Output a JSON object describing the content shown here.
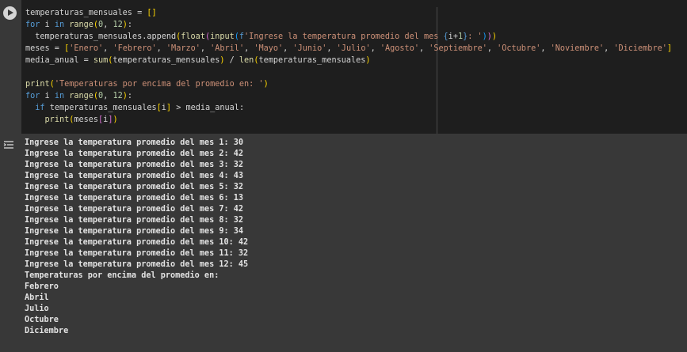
{
  "cell": {
    "run_button_icon": "play-icon",
    "output_icon": "output-toggle-icon",
    "code_lines": [
      [
        {
          "c": "var",
          "t": "temperaturas_mensuales"
        },
        {
          "c": "op",
          "t": " = "
        },
        {
          "c": "br1",
          "t": "[]"
        }
      ],
      [
        {
          "c": "kw",
          "t": "for"
        },
        {
          "c": "var",
          "t": " i "
        },
        {
          "c": "kw",
          "t": "in"
        },
        {
          "c": "var",
          "t": " "
        },
        {
          "c": "fn",
          "t": "range"
        },
        {
          "c": "br1",
          "t": "("
        },
        {
          "c": "num",
          "t": "0"
        },
        {
          "c": "op",
          "t": ", "
        },
        {
          "c": "num",
          "t": "12"
        },
        {
          "c": "br1",
          "t": ")"
        },
        {
          "c": "op",
          "t": ":"
        }
      ],
      [
        {
          "c": "var",
          "t": "  temperaturas_mensuales.append"
        },
        {
          "c": "br1",
          "t": "("
        },
        {
          "c": "fn",
          "t": "float"
        },
        {
          "c": "br2",
          "t": "("
        },
        {
          "c": "fn",
          "t": "input"
        },
        {
          "c": "br3",
          "t": "("
        },
        {
          "c": "kw",
          "t": "f"
        },
        {
          "c": "str",
          "t": "'Ingrese la temperatura promedio del mes "
        },
        {
          "c": "kw",
          "t": "{"
        },
        {
          "c": "var",
          "t": "i"
        },
        {
          "c": "op",
          "t": "+"
        },
        {
          "c": "num",
          "t": "1"
        },
        {
          "c": "kw",
          "t": "}"
        },
        {
          "c": "str",
          "t": ": '"
        },
        {
          "c": "br3",
          "t": ")"
        },
        {
          "c": "br2",
          "t": ")"
        },
        {
          "c": "br1",
          "t": ")"
        }
      ],
      [
        {
          "c": "var",
          "t": "meses"
        },
        {
          "c": "op",
          "t": " = "
        },
        {
          "c": "br1",
          "t": "["
        },
        {
          "c": "str",
          "t": "'Enero'"
        },
        {
          "c": "op",
          "t": ", "
        },
        {
          "c": "str",
          "t": "'Febrero'"
        },
        {
          "c": "op",
          "t": ", "
        },
        {
          "c": "str",
          "t": "'Marzo'"
        },
        {
          "c": "op",
          "t": ", "
        },
        {
          "c": "str",
          "t": "'Abril'"
        },
        {
          "c": "op",
          "t": ", "
        },
        {
          "c": "str",
          "t": "'Mayo'"
        },
        {
          "c": "op",
          "t": ", "
        },
        {
          "c": "str",
          "t": "'Junio'"
        },
        {
          "c": "op",
          "t": ", "
        },
        {
          "c": "str",
          "t": "'Julio'"
        },
        {
          "c": "op",
          "t": ", "
        },
        {
          "c": "str",
          "t": "'Agosto'"
        },
        {
          "c": "op",
          "t": ", "
        },
        {
          "c": "str",
          "t": "'Septiembre'"
        },
        {
          "c": "op",
          "t": ", "
        },
        {
          "c": "str",
          "t": "'Octubre'"
        },
        {
          "c": "op",
          "t": ", "
        },
        {
          "c": "str",
          "t": "'Noviembre'"
        },
        {
          "c": "op",
          "t": ", "
        },
        {
          "c": "str",
          "t": "'Diciembre'"
        },
        {
          "c": "br1",
          "t": "]"
        }
      ],
      [
        {
          "c": "var",
          "t": "media_anual"
        },
        {
          "c": "op",
          "t": " = "
        },
        {
          "c": "fn",
          "t": "sum"
        },
        {
          "c": "br1",
          "t": "("
        },
        {
          "c": "var",
          "t": "temperaturas_mensuales"
        },
        {
          "c": "br1",
          "t": ")"
        },
        {
          "c": "op",
          "t": " / "
        },
        {
          "c": "fn",
          "t": "len"
        },
        {
          "c": "br1",
          "t": "("
        },
        {
          "c": "var",
          "t": "temperaturas_mensuales"
        },
        {
          "c": "br1",
          "t": ")"
        }
      ],
      [],
      [
        {
          "c": "fn",
          "t": "print"
        },
        {
          "c": "br1",
          "t": "("
        },
        {
          "c": "str",
          "t": "'Temperaturas por encima del promedio en: '"
        },
        {
          "c": "br1",
          "t": ")"
        }
      ],
      [
        {
          "c": "kw",
          "t": "for"
        },
        {
          "c": "var",
          "t": " i "
        },
        {
          "c": "kw",
          "t": "in"
        },
        {
          "c": "var",
          "t": " "
        },
        {
          "c": "fn",
          "t": "range"
        },
        {
          "c": "br1",
          "t": "("
        },
        {
          "c": "num",
          "t": "0"
        },
        {
          "c": "op",
          "t": ", "
        },
        {
          "c": "num",
          "t": "12"
        },
        {
          "c": "br1",
          "t": ")"
        },
        {
          "c": "op",
          "t": ":"
        }
      ],
      [
        {
          "c": "var",
          "t": "  "
        },
        {
          "c": "kw",
          "t": "if"
        },
        {
          "c": "var",
          "t": " temperaturas_mensuales"
        },
        {
          "c": "br1",
          "t": "["
        },
        {
          "c": "var",
          "t": "i"
        },
        {
          "c": "br1",
          "t": "]"
        },
        {
          "c": "op",
          "t": " > "
        },
        {
          "c": "var",
          "t": "media_anual"
        },
        {
          "c": "op",
          "t": ":"
        }
      ],
      [
        {
          "c": "var",
          "t": "    "
        },
        {
          "c": "fn",
          "t": "print"
        },
        {
          "c": "br1",
          "t": "("
        },
        {
          "c": "var",
          "t": "meses"
        },
        {
          "c": "br2",
          "t": "["
        },
        {
          "c": "var",
          "t": "i"
        },
        {
          "c": "br2",
          "t": "]"
        },
        {
          "c": "br1",
          "t": ")"
        }
      ]
    ],
    "output_lines": [
      "Ingrese la temperatura promedio del mes 1: 30",
      "Ingrese la temperatura promedio del mes 2: 42",
      "Ingrese la temperatura promedio del mes 3: 32",
      "Ingrese la temperatura promedio del mes 4: 43",
      "Ingrese la temperatura promedio del mes 5: 32",
      "Ingrese la temperatura promedio del mes 6: 13",
      "Ingrese la temperatura promedio del mes 7: 42",
      "Ingrese la temperatura promedio del mes 8: 32",
      "Ingrese la temperatura promedio del mes 9: 34",
      "Ingrese la temperatura promedio del mes 10: 42",
      "Ingrese la temperatura promedio del mes 11: 32",
      "Ingrese la temperatura promedio del mes 12: 45",
      "Temperaturas por encima del promedio en:",
      "Febrero",
      "Abril",
      "Julio",
      "Octubre",
      "Diciembre"
    ]
  },
  "colors": {
    "cell_background": "#383838",
    "editor_background": "#1e1e1e",
    "keyword": "#569cd6",
    "string": "#ce9178",
    "number": "#b5cea8",
    "function": "#dcdcaa",
    "output_text": "#e3e3e3"
  }
}
